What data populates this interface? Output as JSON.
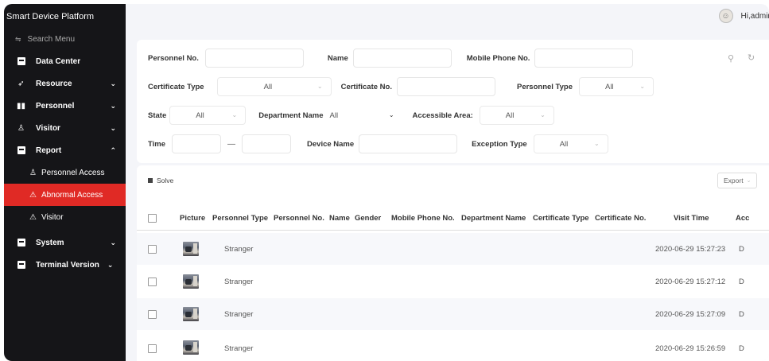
{
  "app": {
    "title": "Smart Device Platform",
    "user_greeting": "Hi,admin"
  },
  "sidebar": {
    "search_placeholder": "Search Menu",
    "items": [
      {
        "label": "Data Center"
      },
      {
        "label": "Resource"
      },
      {
        "label": "Personnel"
      },
      {
        "label": "Visitor"
      },
      {
        "label": "Report"
      },
      {
        "label": "System"
      },
      {
        "label": "Terminal Version"
      }
    ],
    "report_sub": [
      {
        "label": "Personnel Access"
      },
      {
        "label": "Abnormal Access"
      },
      {
        "label": "Visitor"
      }
    ],
    "accent_color": "#e02a25"
  },
  "filters": {
    "personnel_no": "Personnel No.",
    "name": "Name",
    "mobile_phone_no": "Mobile Phone No.",
    "certificate_type": "Certificate Type",
    "certificate_type_value": "All",
    "certificate_no": "Certificate No.",
    "personnel_type": "Personnel Type",
    "personnel_type_value": "All",
    "state": "State",
    "state_value": "All",
    "department_name": "Department Name",
    "department_name_value": "All",
    "accessible_area": "Accessible Area:",
    "accessible_area_value": "All",
    "time": "Time",
    "time_separator": "—",
    "device_name": "Device Name",
    "exception_type": "Exception Type",
    "exception_type_value": "All"
  },
  "table": {
    "solve_label": "Solve",
    "export_label": "Export",
    "columns": [
      "Picture",
      "Personnel Type",
      "Personnel No.",
      "Name",
      "Gender",
      "Mobile Phone No.",
      "Department Name",
      "Certificate Type",
      "Certificate No.",
      "Visit Time",
      "Acc"
    ],
    "rows": [
      {
        "personnel_type": "Stranger",
        "visit_time": "2020-06-29 15:27:23",
        "acc": "D"
      },
      {
        "personnel_type": "Stranger",
        "visit_time": "2020-06-29 15:27:12",
        "acc": "D"
      },
      {
        "personnel_type": "Stranger",
        "visit_time": "2020-06-29 15:27:09",
        "acc": "D"
      },
      {
        "personnel_type": "Stranger",
        "visit_time": "2020-06-29 15:26:59",
        "acc": "D"
      }
    ]
  }
}
